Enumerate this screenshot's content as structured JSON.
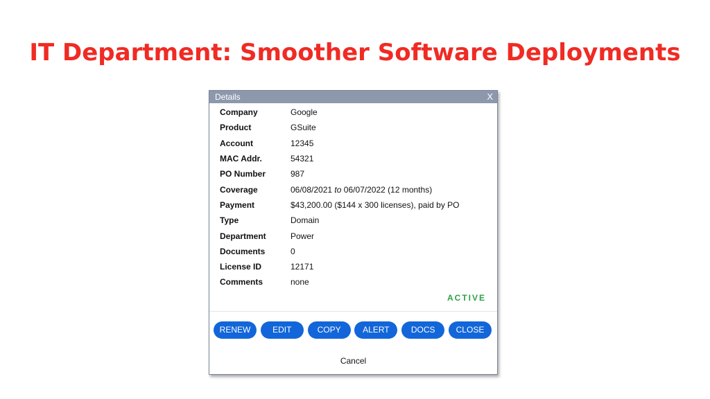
{
  "slide": {
    "title": "IT Department: Smoother Software Deployments"
  },
  "dialog": {
    "title": "Details",
    "close_label": "X",
    "fields": [
      {
        "label": "Company",
        "value": "Google"
      },
      {
        "label": "Product",
        "value": "GSuite"
      },
      {
        "label": "Account",
        "value": "12345"
      },
      {
        "label": "MAC Addr.",
        "value": "54321"
      },
      {
        "label": "PO Number",
        "value": "987"
      },
      {
        "label": "Coverage",
        "value_start": "06/08/2021",
        "value_connector": "to",
        "value_end": "06/07/2022 (12 months)"
      },
      {
        "label": "Payment",
        "value": "$43,200.00 ($144 x 300 licenses), paid by PO"
      },
      {
        "label": "Type",
        "value": "Domain"
      },
      {
        "label": "Department",
        "value": "Power"
      },
      {
        "label": "Documents",
        "value": "0"
      },
      {
        "label": "License ID",
        "value": "12171"
      },
      {
        "label": "Comments",
        "value": "none"
      }
    ],
    "status": "ACTIVE",
    "status_color": "#2e9f47",
    "buttons": [
      "RENEW",
      "EDIT",
      "COPY",
      "ALERT",
      "DOCS",
      "CLOSE"
    ],
    "button_color": "#1266d9",
    "cancel_label": "Cancel"
  },
  "colors": {
    "title": "#ef2b24",
    "titlebar": "#8d98ad"
  }
}
